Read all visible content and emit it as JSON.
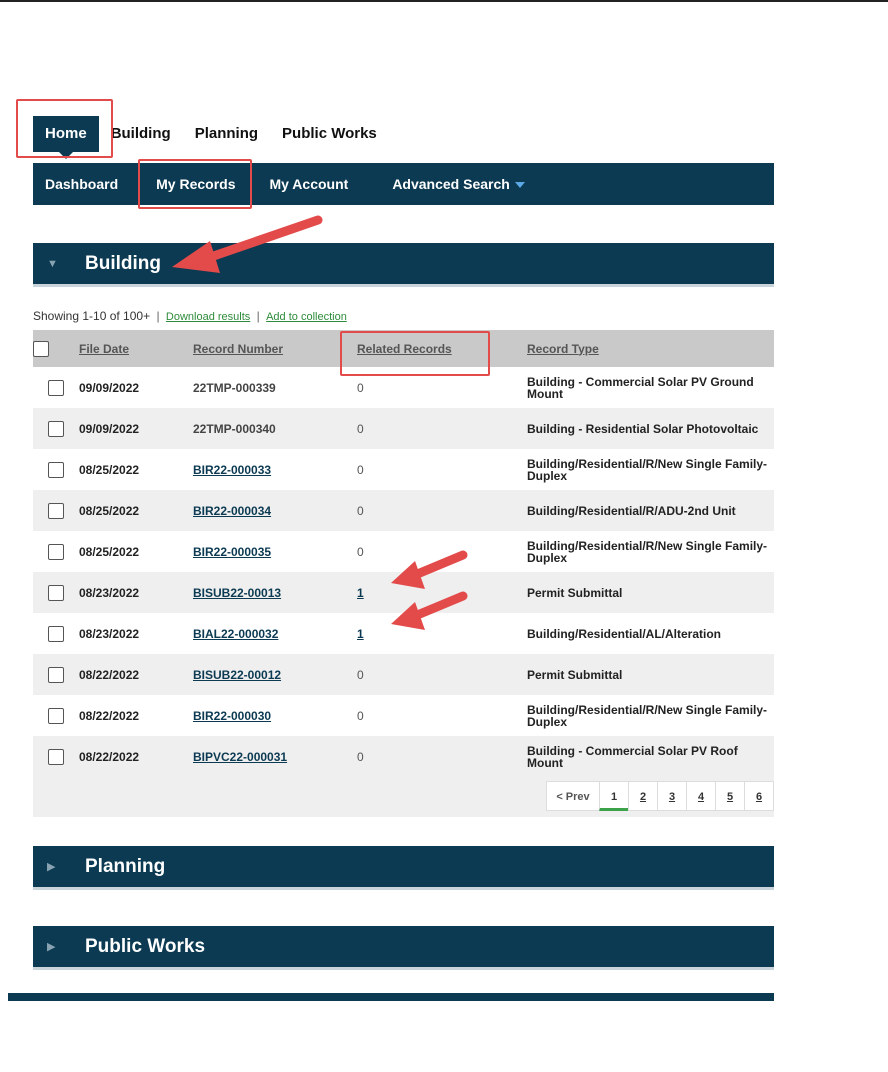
{
  "top_tabs": [
    "Home",
    "Building",
    "Planning",
    "Public Works"
  ],
  "sub_nav": {
    "dashboard": "Dashboard",
    "my_records": "My Records",
    "my_account": "My Account",
    "advanced_search": "Advanced Search"
  },
  "sections": {
    "building": "Building",
    "planning": "Planning",
    "public_works": "Public Works"
  },
  "results": {
    "showing": "Showing 1-10 of 100+",
    "separator": "|",
    "download": "Download results",
    "add_collection": "Add to collection"
  },
  "table": {
    "headers": {
      "file_date": "File Date",
      "record_number": "Record Number",
      "related_records": "Related Records",
      "record_type": "Record Type"
    },
    "rows": [
      {
        "date": "09/09/2022",
        "number": "22TMP-000339",
        "related": "0",
        "type": "Building - Commercial Solar PV Ground Mount"
      },
      {
        "date": "09/09/2022",
        "number": "22TMP-000340",
        "related": "0",
        "type": "Building - Residential Solar Photovoltaic"
      },
      {
        "date": "08/25/2022",
        "number": "BIR22-000033",
        "related": "0",
        "type": "Building/Residential/R/New Single Family-Duplex"
      },
      {
        "date": "08/25/2022",
        "number": "BIR22-000034",
        "related": "0",
        "type": "Building/Residential/R/ADU-2nd Unit"
      },
      {
        "date": "08/25/2022",
        "number": "BIR22-000035",
        "related": "0",
        "type": "Building/Residential/R/New Single Family-Duplex"
      },
      {
        "date": "08/23/2022",
        "number": "BISUB22-00013",
        "related": "1",
        "type": "Permit Submittal"
      },
      {
        "date": "08/23/2022",
        "number": "BIAL22-000032",
        "related": "1",
        "type": "Building/Residential/AL/Alteration"
      },
      {
        "date": "08/22/2022",
        "number": "BISUB22-00012",
        "related": "0",
        "type": "Permit Submittal"
      },
      {
        "date": "08/22/2022",
        "number": "BIR22-000030",
        "related": "0",
        "type": "Building/Residential/R/New Single Family-Duplex"
      },
      {
        "date": "08/22/2022",
        "number": "BIPVC22-000031",
        "related": "0",
        "type": "Building - Commercial Solar PV Roof Mount"
      }
    ]
  },
  "pagination": {
    "prev": "< Prev",
    "pages": [
      "1",
      "2",
      "3",
      "4",
      "5",
      "6"
    ],
    "current": "1"
  },
  "colors": {
    "navy": "#0b3a52",
    "annotation_red": "#e34b4b",
    "link_green": "#2e8b3a",
    "active_page_underline": "#3da34a"
  }
}
